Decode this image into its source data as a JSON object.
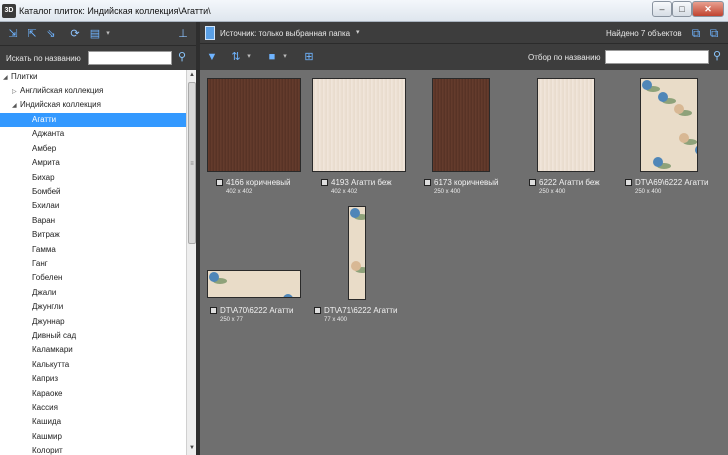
{
  "window": {
    "app_icon_text": "3D",
    "title": "Каталог плиток: Индийская коллекция\\Агатти\\",
    "minimize": "–",
    "maximize": "□",
    "close": "✕"
  },
  "left_panel": {
    "search_label": "Искать по названию",
    "search_value": "",
    "tree": {
      "root": "Плитки",
      "collections": [
        "Английская коллекция",
        "Индийская коллекция"
      ],
      "items": [
        "Агатти",
        "Аджанта",
        "Амбер",
        "Амрита",
        "Бихар",
        "Бомбей",
        "Бхилаи",
        "Варан",
        "Витраж",
        "Гамма",
        "Ганг",
        "Гобелен",
        "Джали",
        "Джунгли",
        "Джуннар",
        "Дивный сад",
        "Каламкари",
        "Калькутта",
        "Каприз",
        "Караоке",
        "Кассия",
        "Кашида",
        "Кашмир",
        "Колорит"
      ],
      "selected": "Агатти"
    }
  },
  "right_panel": {
    "source_label": "Источник: только выбранная папка",
    "found_label": "Найдено 7 объектов",
    "filter_label": "Отбор по названию",
    "filter_value": ""
  },
  "tiles": [
    {
      "name": "4166 коричневый",
      "size": "402 x 402",
      "pattern": "brown"
    },
    {
      "name": "4193 Агатти беж",
      "size": "402 x 402",
      "pattern": "beige"
    },
    {
      "name": "6173 коричневый",
      "size": "250 x 400",
      "pattern": "brown"
    },
    {
      "name": "6222 Агатти беж",
      "size": "250 x 400",
      "pattern": "beige"
    },
    {
      "name": "DT\\A69\\6222 Агатти",
      "size": "250 x 400",
      "pattern": "floral"
    },
    {
      "name": "DT\\A70\\6222 Агатти",
      "size": "250 x 77",
      "pattern": "floral"
    },
    {
      "name": "DT\\A71\\6222 Агатти",
      "size": "77 x 400",
      "pattern": "floral"
    }
  ]
}
